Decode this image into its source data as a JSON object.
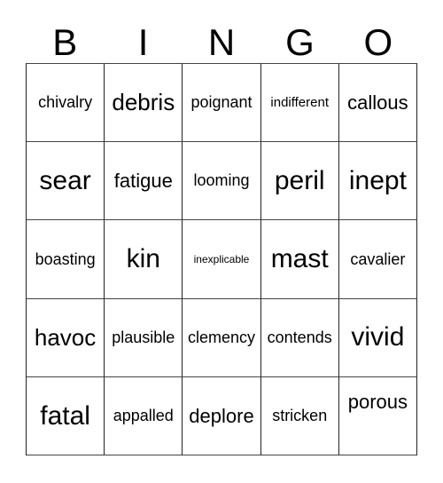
{
  "card": {
    "type": "bingo-card",
    "header_letters": [
      "B",
      "I",
      "N",
      "G",
      "O"
    ],
    "columns": 5,
    "rows": 5,
    "colors": {
      "background": "#ffffff",
      "text": "#000000",
      "grid_line": "#333333"
    },
    "cells": [
      [
        {
          "text": "chivalry",
          "size": "fs-m"
        },
        {
          "text": "debris",
          "size": "fs-xl"
        },
        {
          "text": "poignant",
          "size": "fs-m"
        },
        {
          "text": "indifferent",
          "size": "fs-s"
        },
        {
          "text": "callous",
          "size": "fs-l"
        }
      ],
      [
        {
          "text": "sear",
          "size": "fs-xxl"
        },
        {
          "text": "fatigue",
          "size": "fs-l"
        },
        {
          "text": "looming",
          "size": "fs-m"
        },
        {
          "text": "peril",
          "size": "fs-xxl"
        },
        {
          "text": "inept",
          "size": "fs-xxl"
        }
      ],
      [
        {
          "text": "boasting",
          "size": "fs-m"
        },
        {
          "text": "kin",
          "size": "fs-xxl"
        },
        {
          "text": "inexplicable",
          "size": "fs-xs"
        },
        {
          "text": "mast",
          "size": "fs-xxl"
        },
        {
          "text": "cavalier",
          "size": "fs-m"
        }
      ],
      [
        {
          "text": "havoc",
          "size": "fs-xl"
        },
        {
          "text": "plausible",
          "size": "fs-m"
        },
        {
          "text": "clemency",
          "size": "fs-m"
        },
        {
          "text": "contends",
          "size": "fs-m"
        },
        {
          "text": "vivid",
          "size": "fs-xxl"
        }
      ],
      [
        {
          "text": "fatal",
          "size": "fs-xxl"
        },
        {
          "text": "appalled",
          "size": "fs-m"
        },
        {
          "text": "deplore",
          "size": "fs-l"
        },
        {
          "text": "stricken",
          "size": "fs-m"
        },
        {
          "text": "porous",
          "size": "fs-l",
          "offset": "offset-up"
        }
      ]
    ]
  }
}
